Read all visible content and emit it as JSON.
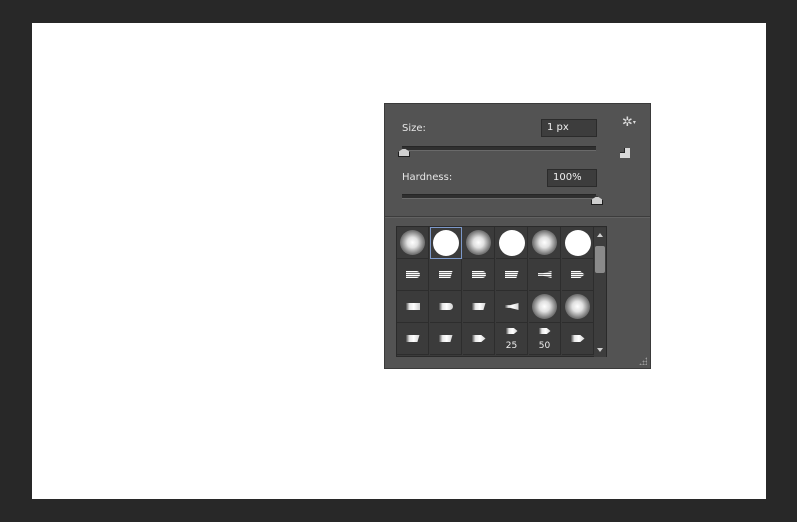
{
  "brush_panel": {
    "size_label": "Size:",
    "size_value": "1 px",
    "size_slider_level": 0.0,
    "hardness_label": "Hardness:",
    "hardness_value": "100%",
    "hardness_slider_level": 1.0,
    "menu_icon": "gear-icon",
    "new_preset_icon": "new-preset-icon",
    "presets": [
      {
        "kind": "soft-round"
      },
      {
        "kind": "hard-round",
        "selected": true
      },
      {
        "kind": "soft-round"
      },
      {
        "kind": "hard-round"
      },
      {
        "kind": "soft-round"
      },
      {
        "kind": "hard-round"
      },
      {
        "kind": "bristle-round"
      },
      {
        "kind": "bristle-flat"
      },
      {
        "kind": "bristle-round"
      },
      {
        "kind": "bristle-flat"
      },
      {
        "kind": "bristle-fan"
      },
      {
        "kind": "bristle-point"
      },
      {
        "kind": "flat-tip"
      },
      {
        "kind": "round-tip"
      },
      {
        "kind": "angled-tip"
      },
      {
        "kind": "fan-tip"
      },
      {
        "kind": "soft-round"
      },
      {
        "kind": "soft-round"
      },
      {
        "kind": "angled-tip"
      },
      {
        "kind": "angled-tip"
      },
      {
        "kind": "point-tip"
      },
      {
        "kind": "point-tip",
        "size_label": "25"
      },
      {
        "kind": "point-tip",
        "size_label": "50"
      },
      {
        "kind": "point-tip"
      }
    ]
  },
  "colors": {
    "app_background": "#282828",
    "document_canvas": "#ffffff",
    "panel_background": "#535353",
    "selection_outline": "#7c98c9"
  }
}
